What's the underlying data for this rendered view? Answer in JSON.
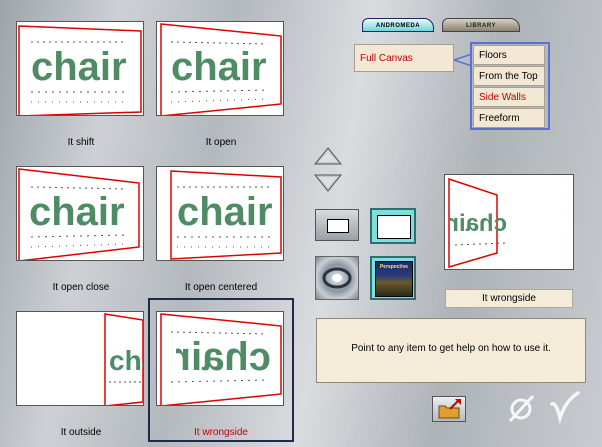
{
  "tabs": [
    {
      "label": "ANDROMEDA",
      "active": true
    },
    {
      "label": "LIBRARY",
      "active": false
    }
  ],
  "canvas_button": {
    "label": "Full Canvas"
  },
  "submenu": {
    "items": [
      {
        "label": "Floors",
        "selected": false
      },
      {
        "label": "From the Top",
        "selected": false
      },
      {
        "label": "Side Walls",
        "selected": true
      },
      {
        "label": "Freeform",
        "selected": false
      }
    ]
  },
  "thumbnails": [
    {
      "caption": "It shift",
      "style": "shift",
      "selected": false
    },
    {
      "caption": "It open",
      "style": "open",
      "selected": false
    },
    {
      "caption": "It open close",
      "style": "open_close",
      "selected": false
    },
    {
      "caption": "It open centered",
      "style": "open_centered",
      "selected": false
    },
    {
      "caption": "It outside",
      "style": "outside",
      "selected": false
    },
    {
      "caption": "It wrongside",
      "style": "wrongside",
      "selected": true
    }
  ],
  "thumbnail_text": "chair",
  "preview": {
    "caption": "It wrongside"
  },
  "tools": {
    "perspective_label": "Perspective"
  },
  "help_text": "Point to any item to get help on how to use it.",
  "colors": {
    "selected_text": "#c00000",
    "accent_border": "#5d6fd0",
    "tab_active": "#6fd6d6"
  },
  "icons": [
    "arrow-up-icon",
    "arrow-down-icon",
    "rect-frame-icon",
    "canvas-frame-icon",
    "distort-icon",
    "perspective-icon",
    "folder-export-icon",
    "cancel-icon",
    "check-icon"
  ]
}
